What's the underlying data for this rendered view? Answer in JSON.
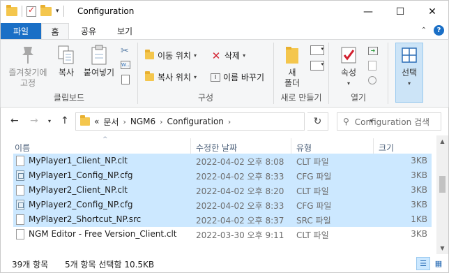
{
  "window": {
    "title": "Configuration",
    "minimize": "—",
    "maximize": "☐",
    "close": "✕"
  },
  "ribbon_tabs": [
    {
      "label": "파일"
    },
    {
      "label": "홈"
    },
    {
      "label": "공유"
    },
    {
      "label": "보기"
    }
  ],
  "ribbon": {
    "clipboard": {
      "pin": "즐겨찾기에\n고정",
      "copy": "복사",
      "paste": "붙여넣기",
      "label": "클립보드"
    },
    "organize": {
      "move_to": "이동 위치",
      "copy_to": "복사 위치",
      "delete": "삭제",
      "rename": "이름 바꾸기",
      "label": "구성"
    },
    "new": {
      "new_folder": "새\n폴더",
      "label": "새로 만들기"
    },
    "open": {
      "properties": "속성",
      "label": "열기"
    },
    "select": {
      "select": "선택"
    }
  },
  "address": {
    "prefix": "«",
    "crumbs": [
      "문서",
      "NGM6",
      "Configuration"
    ],
    "search_placeholder": "Configuration 검색"
  },
  "columns": {
    "name": "이름",
    "date": "수정한 날짜",
    "type": "유형",
    "size": "크기"
  },
  "files": [
    {
      "name": "MyPlayer1_Client_NP.clt",
      "date": "2022-04-02 오후 8:08",
      "type": "CLT 파일",
      "size": "3KB",
      "selected": true,
      "icon": "generic-file-icon"
    },
    {
      "name": "MyPlayer1_Config_NP.cfg",
      "date": "2022-04-02 오후 8:33",
      "type": "CFG 파일",
      "size": "3KB",
      "selected": true,
      "icon": "config-file-icon"
    },
    {
      "name": "MyPlayer2_Client_NP.clt",
      "date": "2022-04-02 오후 8:20",
      "type": "CLT 파일",
      "size": "3KB",
      "selected": true,
      "icon": "generic-file-icon"
    },
    {
      "name": "MyPlayer2_Config_NP.cfg",
      "date": "2022-04-02 오후 8:33",
      "type": "CFG 파일",
      "size": "3KB",
      "selected": true,
      "icon": "config-file-icon"
    },
    {
      "name": "MyPlayer2_Shortcut_NP.src",
      "date": "2022-04-02 오후 8:37",
      "type": "SRC 파일",
      "size": "1KB",
      "selected": true,
      "icon": "generic-file-icon"
    },
    {
      "name": "NGM Editor - Free Version_Client.clt",
      "date": "2022-03-30 오후 9:11",
      "type": "CLT 파일",
      "size": "3KB",
      "selected": false,
      "icon": "generic-file-icon"
    }
  ],
  "status": {
    "item_count": "39개 항목",
    "selection": "5개 항목 선택함 10.5KB"
  },
  "colors": {
    "accent": "#1a6fc6",
    "selection": "#cce8ff"
  }
}
